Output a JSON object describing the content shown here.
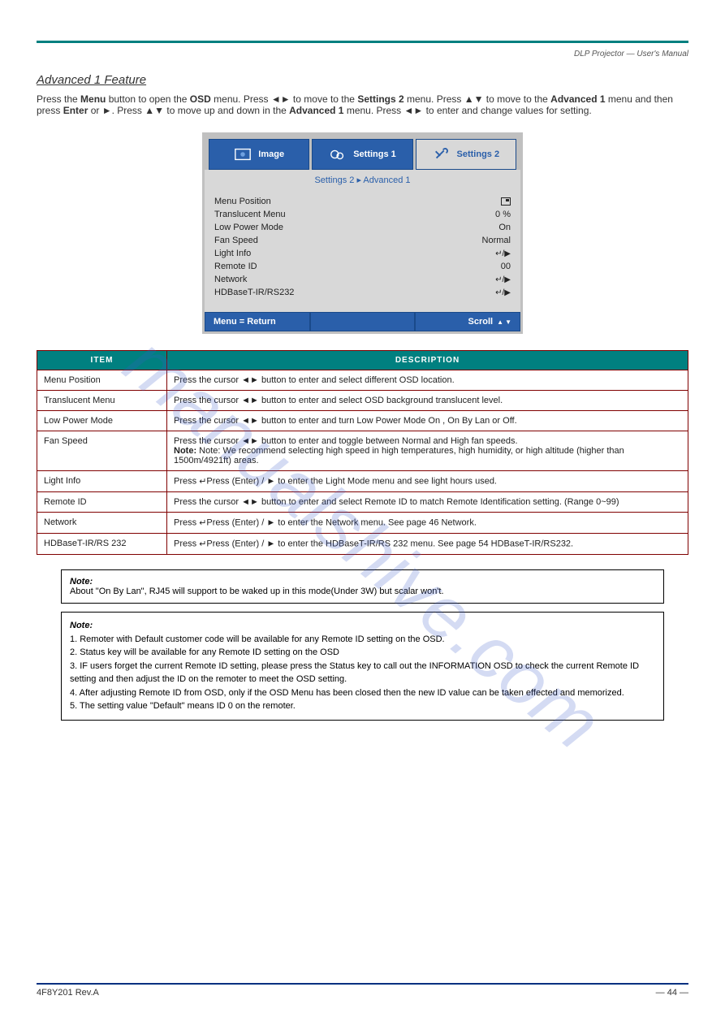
{
  "watermark": "manualshive.com",
  "header": {
    "right": "DLP Projector — User's Manual"
  },
  "feature": {
    "title": "Advanced 1 Feature",
    "nav_prefix": "Press the ",
    "nav_menu": "Menu",
    "nav_mid1": " button to open the ",
    "nav_osd": "OSD",
    "nav_mid2": " menu. Press ◄► to move to the ",
    "nav_s2": "Settings 2",
    "nav_mid3": " menu. Press ▲▼ to move to the ",
    "nav_adv": "Advanced 1",
    "nav_mid4": " menu and then press ",
    "nav_enter": "Enter",
    "nav_or": " or ►. Press ▲▼ to move up and down in the ",
    "nav_end": " menu. Press ◄► to enter and change values for setting."
  },
  "osd": {
    "tabs": {
      "image": "Image",
      "s1": "Settings 1",
      "s2": "Settings 2"
    },
    "breadcrumb": "Settings 2 ▸ Advanced 1",
    "items": [
      {
        "label": "Menu Position",
        "value_type": "posicon"
      },
      {
        "label": "Translucent Menu",
        "value": "0 %"
      },
      {
        "label": "Low Power Mode",
        "value": "On"
      },
      {
        "label": "Fan Speed",
        "value": "Normal"
      },
      {
        "label": "Light Info",
        "value_type": "select"
      },
      {
        "label": "Remote ID",
        "value": "00"
      },
      {
        "label": "Network",
        "value_type": "select"
      },
      {
        "label": "HDBaseT-IR/RS232",
        "value_type": "select"
      }
    ],
    "footer": {
      "left": "Menu = Return",
      "right": "Scroll"
    }
  },
  "table": {
    "headers": {
      "item": "ITEM",
      "desc": "DESCRIPTION"
    },
    "rows": [
      {
        "item": "Menu Position",
        "desc": "Press the cursor ◄► button to enter and select different OSD location."
      },
      {
        "item": "Translucent Menu",
        "desc": "Press the cursor ◄► button to enter and select OSD background translucent level."
      },
      {
        "item": "Low Power Mode",
        "desc": "Press the cursor ◄► button to enter and turn Low Power Mode On , On By Lan or Off."
      },
      {
        "item": "Fan Speed",
        "desc_lines": [
          "Press the cursor ◄► button to enter and toggle between Normal and High fan speeds.",
          "Note: We recommend selecting high speed in high temperatures, high humidity, or high altitude (higher than 1500m/4921ft) areas."
        ]
      },
      {
        "item": "Light Info",
        "desc": "Press  (Enter) / ► to enter the Light Mode menu and see light hours used."
      },
      {
        "item": "Remote ID",
        "desc": "Press the cursor ◄► button to enter and select Remote ID to match Remote Identification setting. (Range 0~99)"
      },
      {
        "item": "Network",
        "desc": "Press  (Enter) / ► to enter the Network menu. See page 46 Network."
      },
      {
        "item": "HDBaseT-IR/RS 232",
        "desc": "Press  (Enter) / ► to enter the HDBaseT-IR/RS 232 menu. See page 54 HDBaseT-IR/RS232."
      }
    ]
  },
  "notes": {
    "n1_prefix": "About \"On By Lan\", RJ45 will support to be waked up in this mode(Under 3W) but scalar won't.",
    "n2_lines": [
      "1. Remoter with Default customer code will be available for any Remote ID setting on the OSD.",
      "2. Status key will be available for any Remote ID setting on the OSD",
      "3. IF users forget the current Remote ID setting, please press the Status key to call out the INFORMATION OSD to check the current Remote ID setting and then adjust the ID on the remoter to meet the OSD setting.",
      "4. After adjusting Remote ID from OSD, only if the OSD Menu has been closed then the new ID value can be taken effected and memorized.",
      "5. The setting value \"Default\" means ID 0 on the remoter."
    ],
    "label": "Note:"
  },
  "footer": {
    "left": "4F8Y201 Rev.A",
    "right": "— 44 —"
  }
}
